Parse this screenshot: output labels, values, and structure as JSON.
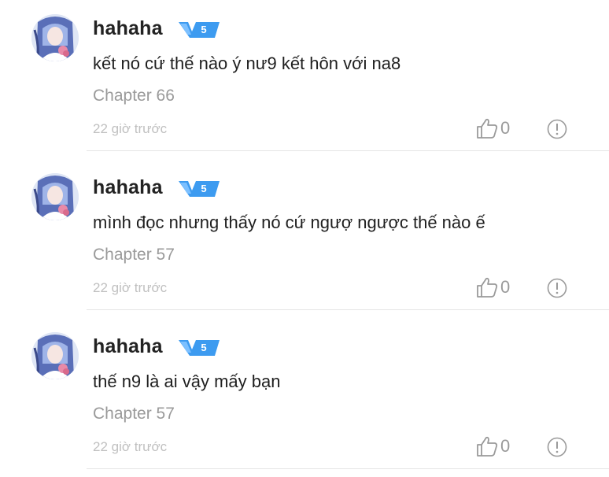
{
  "comments": [
    {
      "username": "hahaha",
      "level": "5",
      "content": "kết nó cứ thế nào ý nư9 kết hôn với na8",
      "chapter": "Chapter 66",
      "time": "22 giờ trước",
      "likes": "0"
    },
    {
      "username": "hahaha",
      "level": "5",
      "content": "mình đọc nhưng thấy nó cứ ngượ ngược thế nào ế",
      "chapter": "Chapter 57",
      "time": "22 giờ trước",
      "likes": "0"
    },
    {
      "username": "hahaha",
      "level": "5",
      "content": "thế n9 là ai vậy mấy bạn",
      "chapter": "Chapter 57",
      "time": "22 giờ trước",
      "likes": "0"
    }
  ],
  "colors": {
    "badge": "#3d9bf0",
    "muted_text": "#9a9a9a",
    "time_text": "#c0c0c0",
    "divider": "#e6e6e6"
  },
  "icons": {
    "avatar": "anime-avatar",
    "badge": "level-badge-v",
    "like": "thumbs-up-icon",
    "report": "report-exclamation-icon"
  }
}
